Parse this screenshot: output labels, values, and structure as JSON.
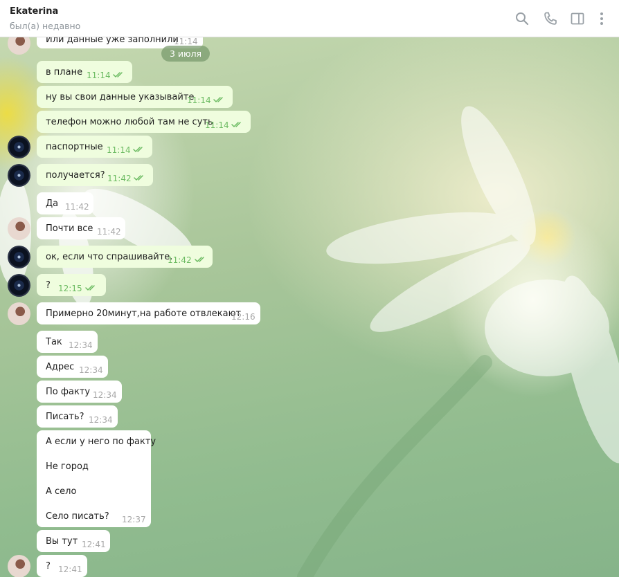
{
  "header": {
    "title": "Ekaterina",
    "status": "был(а) недавно",
    "icons": [
      "search-icon",
      "phone-icon",
      "sidebar-toggle-icon",
      "more-icon"
    ]
  },
  "date_divider": "3 июля",
  "messages": [
    {
      "text": "Или данные уже заполнили",
      "time": "11:14",
      "direction": "in",
      "avatar": "photo"
    },
    {
      "text": "в плане",
      "time": "11:14",
      "direction": "out",
      "read": true
    },
    {
      "text": "ну вы свои данные указывайте",
      "time": "11:14",
      "direction": "out",
      "read": true
    },
    {
      "text": "телефон можно любой там не суть",
      "time": "11:14",
      "direction": "out",
      "read": true
    },
    {
      "text": "паспортные",
      "time": "11:14",
      "direction": "out",
      "read": true,
      "avatar": "camera"
    },
    {
      "text": "получается?",
      "time": "11:42",
      "direction": "out",
      "read": true,
      "avatar": "camera"
    },
    {
      "text": "Да",
      "time": "11:42",
      "direction": "in"
    },
    {
      "text": "Почти все",
      "time": "11:42",
      "direction": "in",
      "avatar": "photo"
    },
    {
      "text": "ок, если что спрашивайте.",
      "time": "11:42",
      "direction": "out",
      "read": true,
      "avatar": "camera"
    },
    {
      "text": "?",
      "time": "12:15",
      "direction": "out",
      "read": true,
      "avatar": "camera"
    },
    {
      "text": "Примерно 20минут,на работе отвлекают",
      "time": "12:16",
      "direction": "in",
      "avatar": "photo"
    },
    {
      "text": "Так",
      "time": "12:34",
      "direction": "in"
    },
    {
      "text": "Адрес",
      "time": "12:34",
      "direction": "in"
    },
    {
      "text": "По факту",
      "time": "12:34",
      "direction": "in"
    },
    {
      "text": "Писать?",
      "time": "12:34",
      "direction": "in"
    },
    {
      "lines": [
        "А если у него по факту",
        "Не город",
        "А село",
        "Село писать?"
      ],
      "time": "12:37",
      "direction": "in"
    },
    {
      "text": "Вы тут",
      "time": "12:41",
      "direction": "in"
    },
    {
      "text": "?",
      "time": "12:41",
      "direction": "in",
      "avatar": "photo"
    }
  ],
  "colors": {
    "incoming_bubble": "#ffffff",
    "outgoing_bubble": "#effdde",
    "read_ticks": "#6cbb62",
    "date_pill": "#7a9b6e"
  }
}
